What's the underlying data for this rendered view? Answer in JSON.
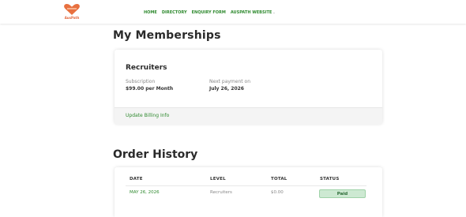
{
  "header": {
    "logo_text": "AusPath",
    "nav": [
      {
        "label": "HOME"
      },
      {
        "label": "DIRECTORY"
      },
      {
        "label": "ENQUIRY FORM"
      },
      {
        "label": "AUSPATH WEBSITE"
      }
    ],
    "chevron": "⌄"
  },
  "memberships": {
    "title": "My Memberships",
    "card": {
      "name": "Recruiters",
      "subscription_label": "Subscription",
      "subscription_value": "$99.00 per Month",
      "next_payment_label": "Next payment on",
      "next_payment_value": "July 26, 2026",
      "billing_link": "Update Billing Info"
    }
  },
  "orders": {
    "title": "Order History",
    "columns": [
      "DATE",
      "LEVEL",
      "TOTAL",
      "STATUS"
    ],
    "rows": [
      {
        "date": "MAY 26, 2026",
        "level": "Recruiters",
        "total": "$0.00",
        "status": "Paid"
      }
    ]
  },
  "colors": {
    "accent_green": "#2f8a2f",
    "logo_orange": "#e2673d",
    "paid_badge": "#cde9d2"
  },
  "icons": {
    "logo": "heart-logo-icon"
  }
}
